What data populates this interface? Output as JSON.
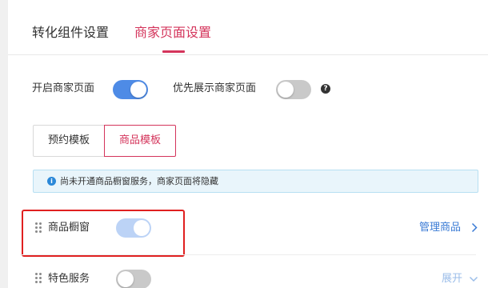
{
  "tabs": {
    "conversion": "转化组件设置",
    "merchant": "商家页面设置"
  },
  "settings": {
    "enable_merchant_page": {
      "label": "开启商家页面",
      "on": true
    },
    "prioritize_merchant_page": {
      "label": "优先展示商家页面",
      "on": false
    }
  },
  "template_selector": {
    "options": [
      "预约模板",
      "商品模板"
    ],
    "selected": "商品模板"
  },
  "notice": {
    "text": "尚未开通商品橱窗服务，商家页面将隐藏"
  },
  "modules": [
    {
      "label": "商品橱窗",
      "on": true,
      "disabled": true,
      "action": "管理商品"
    },
    {
      "label": "特色服务",
      "on": false,
      "disabled": false,
      "action": "展开"
    }
  ],
  "colors": {
    "accent": "#d4345b",
    "switch_on": "#4e8be6",
    "link": "#3a7bd5",
    "highlight": "#e02020"
  }
}
